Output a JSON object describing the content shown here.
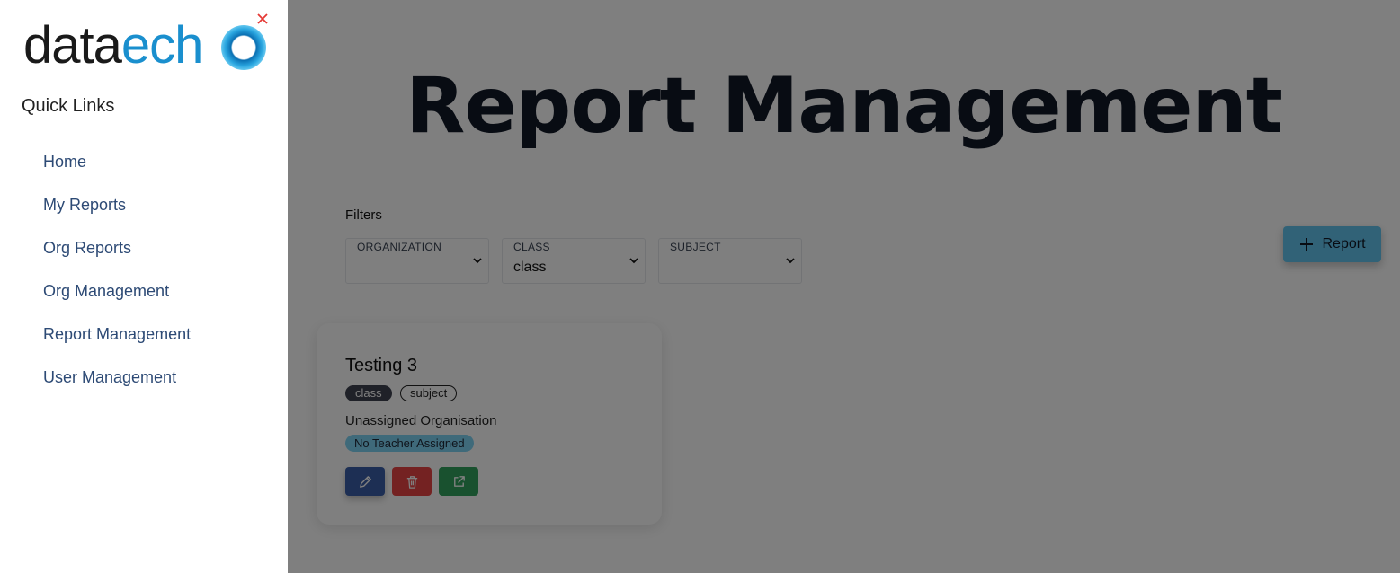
{
  "sidebar": {
    "logo": {
      "part1": "data",
      "part2": "ech",
      "part3": "o"
    },
    "quick_links_title": "Quick Links",
    "items": [
      {
        "label": "Home"
      },
      {
        "label": "My Reports"
      },
      {
        "label": "Org Reports"
      },
      {
        "label": "Org Management"
      },
      {
        "label": "Report Management"
      },
      {
        "label": "User Management"
      }
    ]
  },
  "main": {
    "title": "Report Management",
    "filters": {
      "label": "Filters",
      "organization": {
        "label": "ORGANIZATION",
        "value": ""
      },
      "class": {
        "label": "CLASS",
        "value": "class"
      },
      "subject": {
        "label": "SUBJECT",
        "value": ""
      }
    },
    "add_report_label": "Report",
    "cards": [
      {
        "title": "Testing 3",
        "tags": [
          "class",
          "subject"
        ],
        "organisation": "Unassigned Organisation",
        "teacher_badge": "No Teacher Assigned"
      }
    ]
  },
  "colors": {
    "nav_text": "#2d4a75",
    "brand_blue": "#1a8fce",
    "add_button": "#63c5ef",
    "edit_button": "#3a5ea8",
    "delete_button": "#e84545",
    "open_button": "#32a35e",
    "close_icon": "#e53935"
  }
}
